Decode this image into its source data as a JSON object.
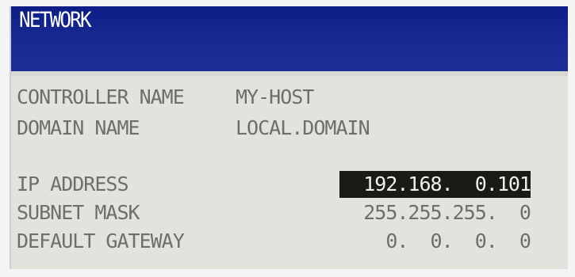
{
  "window": {
    "title": "NETWORK"
  },
  "network": {
    "controller_name_label": "CONTROLLER NAME",
    "controller_name_value": "MY-HOST",
    "domain_name_label": "DOMAIN NAME",
    "domain_name_value": "LOCAL.DOMAIN",
    "ip_address_label": "IP ADDRESS",
    "ip_address_value": "192.168.  0.101",
    "subnet_mask_label": "SUBNET MASK",
    "subnet_mask_value": "255.255.255.  0",
    "default_gateway_label": "DEFAULT GATEWAY",
    "default_gateway_value": "  0.  0.  0.  0"
  },
  "colors": {
    "title_bar": "#182b93",
    "background": "#e3e3de",
    "text": "#6d6e6d",
    "selection_background": "#1c1a16",
    "selection_text": "#f0f0ec"
  }
}
